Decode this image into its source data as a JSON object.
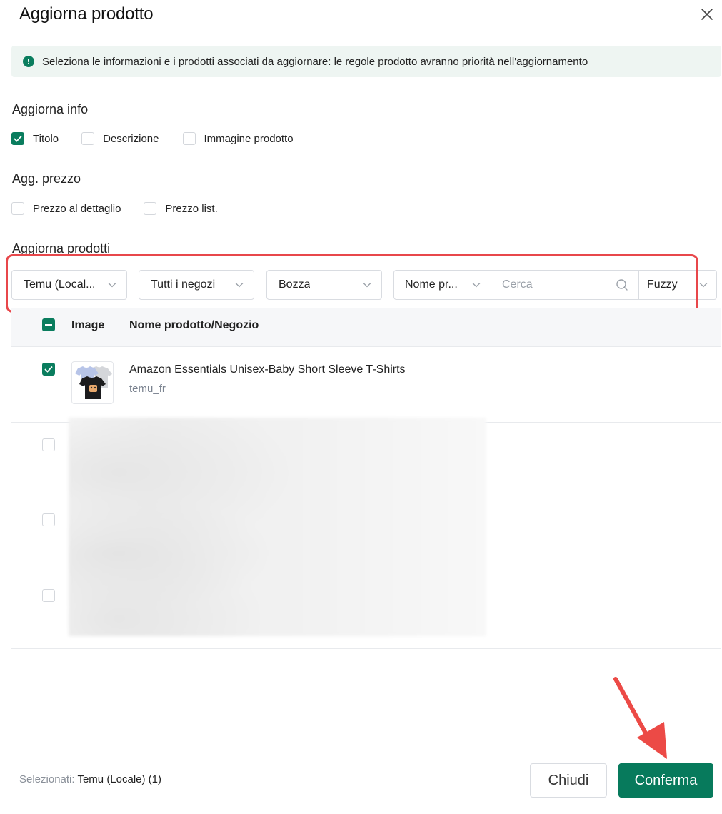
{
  "dialog": {
    "title": "Aggiorna prodotto"
  },
  "alert": {
    "text": "Seleziona le informazioni e i prodotti associati da aggiornare: le regole prodotto avranno priorità nell'aggiornamento"
  },
  "update_info": {
    "label": "Aggiorna info",
    "options": [
      {
        "label": "Titolo",
        "checked": true
      },
      {
        "label": "Descrizione",
        "checked": false
      },
      {
        "label": "Immagine prodotto",
        "checked": false
      }
    ]
  },
  "update_price": {
    "label": "Agg. prezzo",
    "options": [
      {
        "label": "Prezzo al dettaglio",
        "checked": false
      },
      {
        "label": "Prezzo list.",
        "checked": false
      }
    ]
  },
  "update_products": {
    "label": "Aggiorna prodotti",
    "filters": {
      "platform": "Temu (Local...",
      "store": "Tutti i negozi",
      "status": "Bozza",
      "search_field": "Nome pr...",
      "search_placeholder": "Cerca",
      "match_mode": "Fuzzy"
    },
    "table": {
      "columns": [
        "Image",
        "Nome prodotto/Negozio"
      ],
      "rows": [
        {
          "name": "Amazon Essentials Unisex-Baby Short Sleeve T-Shirts",
          "store": "temu_fr",
          "checked": true
        }
      ]
    }
  },
  "footer": {
    "selected_label": "Selezionati:",
    "selected_value": "Temu (Locale) (1)",
    "close_label": "Chiudi",
    "confirm_label": "Conferma"
  },
  "colors": {
    "accent": "#077a5c",
    "highlight": "#e8474b"
  }
}
